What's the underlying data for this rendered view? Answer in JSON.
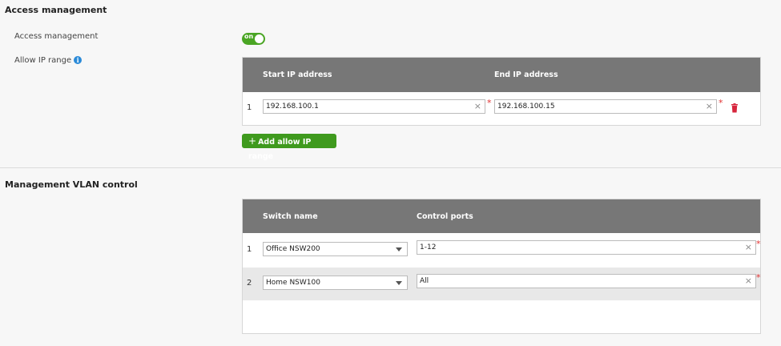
{
  "access": {
    "section_title": "Access management",
    "toggle_label": "Access management",
    "toggle_state": "on",
    "allow_ip_label": "Allow IP range",
    "info_icon": "info-icon",
    "columns": [
      "Start IP address",
      "End IP address"
    ],
    "rows": [
      {
        "index": "1",
        "start": "192.168.100.1",
        "end": "192.168.100.15"
      }
    ],
    "add_button": "Add allow IP range",
    "required_mark": "*",
    "clear_mark": "×"
  },
  "vlan": {
    "section_title": "Management VLAN control",
    "columns": [
      "Switch name",
      "Control ports"
    ],
    "rows": [
      {
        "index": "1",
        "switch": "Office NSW200",
        "ports": "1-12"
      },
      {
        "index": "2",
        "switch": "Home NSW100",
        "ports": "All"
      }
    ]
  },
  "colors": {
    "accent_green": "#4aa524",
    "button_green": "#3f9a1e",
    "header_gray": "#777777",
    "required_red": "#e03030",
    "info_blue": "#2a8ad8",
    "trash_red": "#d7263d"
  }
}
